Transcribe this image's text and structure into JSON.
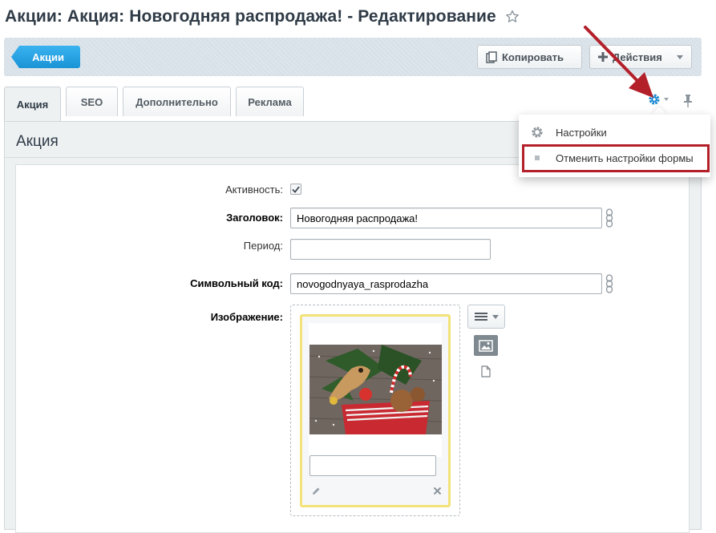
{
  "header": {
    "title": "Акции: Акция: Новогодняя распродажа! - Редактирование"
  },
  "toolbar": {
    "back_label": "Акции",
    "copy_label": "Копировать",
    "actions_label": "Действия"
  },
  "tabs": [
    {
      "label": "Акция",
      "active": true
    },
    {
      "label": "SEO",
      "active": false
    },
    {
      "label": "Дополнительно",
      "active": false
    },
    {
      "label": "Реклама",
      "active": false
    }
  ],
  "settings_menu": {
    "items": [
      {
        "label": "Настройки",
        "icon": "gear-icon"
      },
      {
        "label": "Отменить настройки формы",
        "icon": "bullet-icon",
        "highlighted": true
      }
    ]
  },
  "section": {
    "title": "Акция"
  },
  "form": {
    "active": {
      "label": "Активность:",
      "checked": true
    },
    "title": {
      "label": "Заголовок:",
      "value": "Новогодняя распродажа!"
    },
    "period": {
      "label": "Период:",
      "value": ""
    },
    "code": {
      "label": "Символьный код:",
      "value": "novogodnyaya_rasprodazha"
    },
    "image": {
      "label": "Изображение:",
      "description": ""
    }
  },
  "colors": {
    "accent_blue": "#1a93d6",
    "highlight_red": "#b3202a",
    "toolbar_bg": "#d7e0e8",
    "image_card_border": "#f3e27a"
  }
}
